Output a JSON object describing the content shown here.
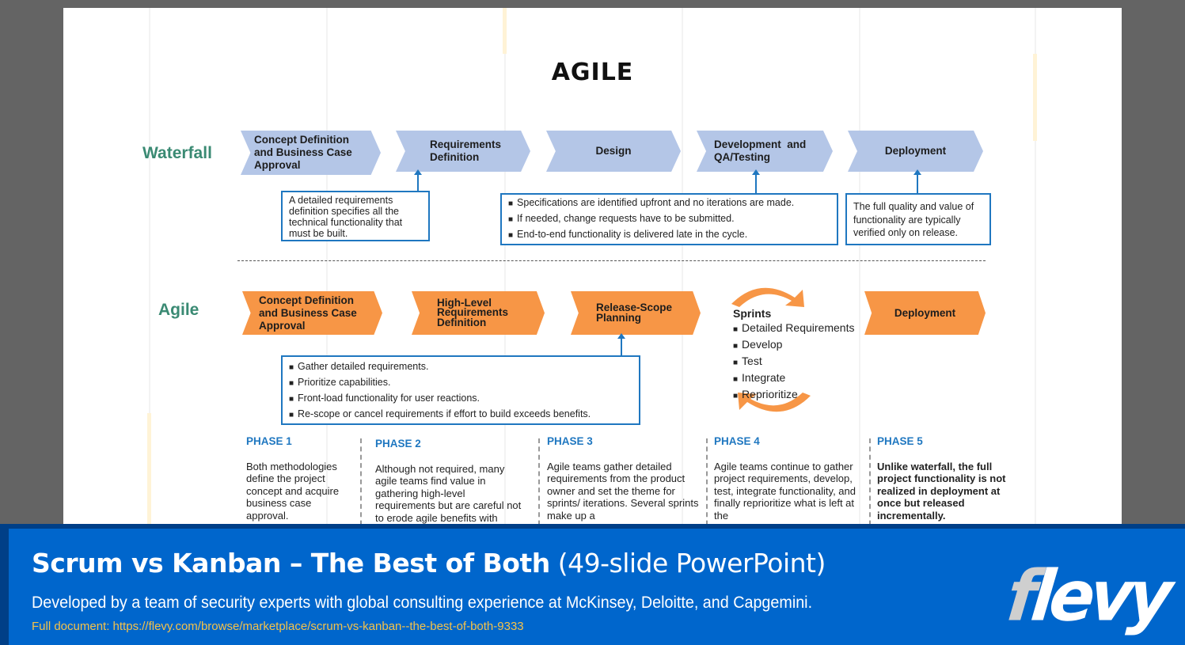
{
  "slide": {
    "title": "AGILE",
    "waterfall": {
      "label": "Waterfall",
      "steps": [
        "Concept Definition and Business Case Approval",
        "Requirements Definition",
        "Design",
        "Development  and QA/Testing",
        "Deployment"
      ],
      "callout_requirements": "A detailed requirements definition specifies all the technical functionality that must be built.",
      "callout_development": [
        "Specifications are identified upfront and no iterations are made.",
        "If needed, change requests have to be submitted.",
        "End-to-end functionality is delivered late in the cycle."
      ],
      "callout_deployment": "The full quality and value of functionality are typically verified only on release."
    },
    "agile": {
      "label": "Agile",
      "steps": [
        "Concept Definition and Business Case Approval",
        "High-Level Requirements Definition",
        "Release-Scope Planning",
        "Deployment"
      ],
      "callout_release": [
        "Gather detailed requirements.",
        "Prioritize capabilities.",
        "Front-load functionality for user reactions.",
        "Re-scope or cancel requirements if effort to build exceeds benefits."
      ],
      "sprints": {
        "title": "Sprints",
        "items": [
          "Detailed Requirements",
          "Develop",
          "Test",
          "Integrate",
          "Reprioritize"
        ]
      }
    },
    "phases": [
      {
        "title": "PHASE 1",
        "text": "Both methodologies define the project concept and acquire business case approval."
      },
      {
        "title": "PHASE 2",
        "text": "Although not required, many agile teams find value in gathering high-level requirements but are careful not to erode agile benefits with"
      },
      {
        "title": "PHASE 3",
        "text": "Agile teams gather detailed requirements from the product owner and set the theme for sprints/ iterations. Several sprints make up a"
      },
      {
        "title": "PHASE 4",
        "text": "Agile teams continue to gather project requirements, develop, test, integrate functionality, and finally reprioritize what is left at the"
      },
      {
        "title": "PHASE 5",
        "text": "Unlike waterfall, the full project functionality is not realized in deployment at once but released incrementally."
      }
    ]
  },
  "banner": {
    "title_bold": "Scrum vs Kanban – The Best of Both",
    "title_light": " (49-slide PowerPoint)",
    "description": "Developed by a team of security experts with global consulting experience at McKinsey, Deloitte, and Capgemini.",
    "link": "Full document: https://flevy.com/browse/marketplace/scrum-vs-kanban--the-best-of-both-9333",
    "logo_first": "f",
    "logo_rest": "levy"
  },
  "colors": {
    "waterfall_chevron": "#b4c6e7",
    "agile_chevron": "#f79646",
    "accent_blue": "#1f77c0",
    "label_green": "#3a8a73",
    "banner_blue": "#0066cc",
    "link_yellow": "#f5c24a"
  }
}
